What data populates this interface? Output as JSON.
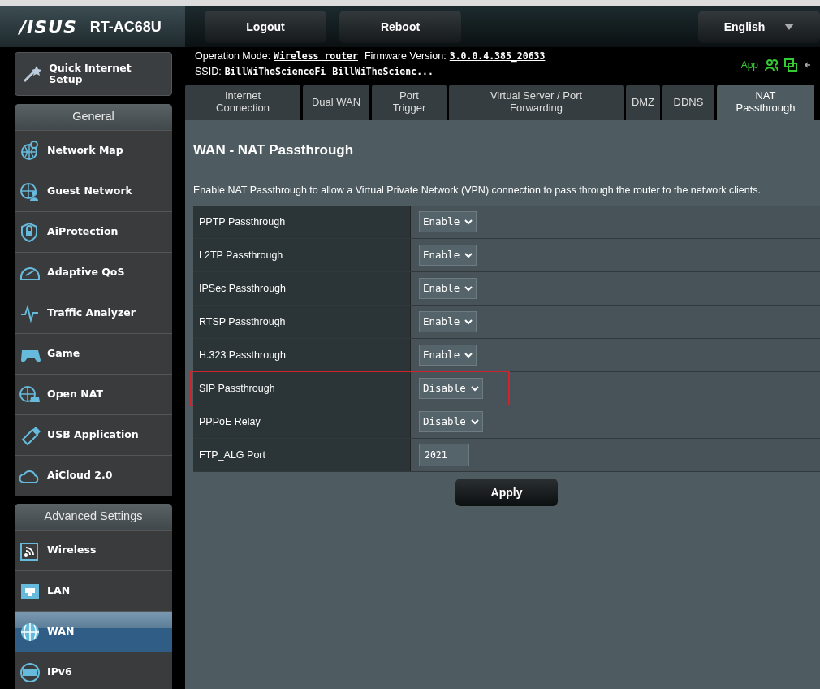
{
  "header": {
    "logo": "/ISUS",
    "model": "RT-AC68U",
    "buttons": [
      "Logout",
      "Reboot"
    ],
    "language": "English"
  },
  "info": {
    "mode_label": "Operation Mode:",
    "mode": "Wireless router",
    "fw_label": "Firmware Version:",
    "fw": "3.0.0.4.385_20633",
    "ssid_label": "SSID:",
    "ssids": [
      "BillWiTheScienceFi",
      "BillWiTheScienc..."
    ],
    "app": "App"
  },
  "sidebar": {
    "quick_setup": "Quick Internet Setup",
    "sections": [
      {
        "title": "General",
        "items": [
          {
            "label": "Network Map",
            "selected": false
          },
          {
            "label": "Guest Network",
            "selected": false
          },
          {
            "label": "AiProtection",
            "selected": false
          },
          {
            "label": "Adaptive QoS",
            "selected": false
          },
          {
            "label": "Traffic Analyzer",
            "selected": false
          },
          {
            "label": "Game",
            "selected": false
          },
          {
            "label": "Open NAT",
            "selected": false
          },
          {
            "label": "USB Application",
            "selected": false
          },
          {
            "label": "AiCloud 2.0",
            "selected": false
          }
        ]
      },
      {
        "title": "Advanced Settings",
        "items": [
          {
            "label": "Wireless",
            "selected": false
          },
          {
            "label": "LAN",
            "selected": false
          },
          {
            "label": "WAN",
            "selected": true
          },
          {
            "label": "IPv6",
            "selected": false
          }
        ]
      }
    ]
  },
  "tabs": [
    {
      "label": "Internet Connection",
      "selected": false
    },
    {
      "label": "Dual WAN",
      "selected": false
    },
    {
      "label": "Port Trigger",
      "selected": false
    },
    {
      "label": "Virtual Server / Port Forwarding",
      "selected": false
    },
    {
      "label": "DMZ",
      "selected": false
    },
    {
      "label": "DDNS",
      "selected": false
    },
    {
      "label": "NAT Passthrough",
      "selected": true
    }
  ],
  "page": {
    "title": "WAN - NAT Passthrough",
    "description": "Enable NAT Passthrough to allow a Virtual Private Network (VPN) connection to pass through the router to the network clients.",
    "rows": [
      {
        "label": "PPTP Passthrough",
        "kind": "select",
        "value": "Enable",
        "highlighted": false
      },
      {
        "label": "L2TP Passthrough",
        "kind": "select",
        "value": "Enable",
        "highlighted": false
      },
      {
        "label": "IPSec Passthrough",
        "kind": "select",
        "value": "Enable",
        "highlighted": false
      },
      {
        "label": "RTSP Passthrough",
        "kind": "select",
        "value": "Enable",
        "highlighted": false
      },
      {
        "label": "H.323 Passthrough",
        "kind": "select",
        "value": "Enable",
        "highlighted": false
      },
      {
        "label": "SIP Passthrough",
        "kind": "select",
        "value": "Disable",
        "highlighted": true
      },
      {
        "label": "PPPoE Relay",
        "kind": "select",
        "value": "Disable",
        "highlighted": false
      },
      {
        "label": "FTP_ALG Port",
        "kind": "text",
        "value": "2021",
        "highlighted": false
      }
    ],
    "apply": "Apply"
  }
}
